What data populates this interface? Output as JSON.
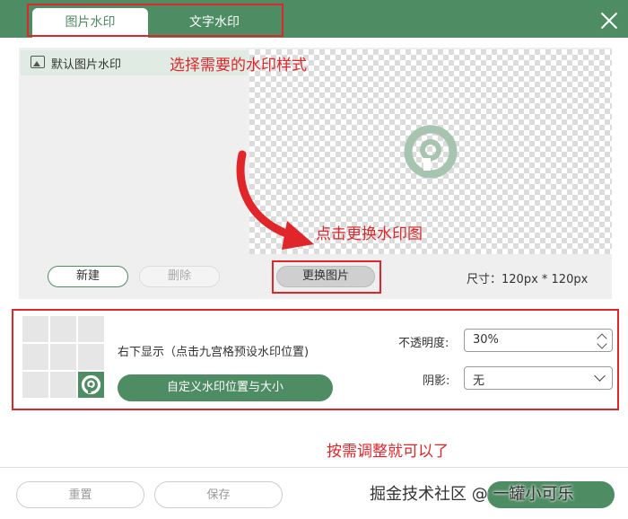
{
  "tabs": [
    {
      "label": "图片水印"
    },
    {
      "label": "文字水印"
    }
  ],
  "sidebar": {
    "items": [
      {
        "label": "默认图片水印"
      }
    ],
    "new_button": "新建",
    "delete_button": "删除"
  },
  "preview": {
    "replace_button": "更换图片",
    "size_text": "尺寸：120px * 120px"
  },
  "annotations": {
    "select_style": "选择需要的水印样式",
    "click_replace": "点击更换水印图",
    "adjust": "按需调整就可以了"
  },
  "position": {
    "grid_selected": "bottom-right",
    "text": "右下显示（点击九宫格预设水印位置)",
    "custom_button": "自定义水印位置与大小"
  },
  "opacity": {
    "label": "不透明度:",
    "value": "30%"
  },
  "shadow": {
    "label": "阴影:",
    "value": "无"
  },
  "footer": {
    "reset_button": "重置",
    "save_button": "保存",
    "brand": "掘金技术社区 @ 一罐小可乐"
  },
  "colors": {
    "accent": "#4e8c63",
    "annotation": "#e0262a"
  },
  "icons": [
    "close-icon",
    "image-icon",
    "watermark-logo-icon",
    "spinner-up-icon",
    "spinner-down-icon",
    "chevron-down-icon"
  ]
}
